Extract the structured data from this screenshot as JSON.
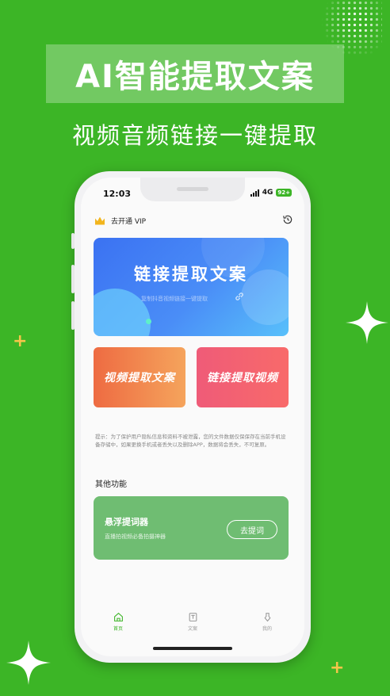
{
  "promo": {
    "headline": "AI智能提取文案",
    "subtitle": "视频音频链接一键提取"
  },
  "status_bar": {
    "time": "12:03",
    "network": "4G",
    "battery": "92+"
  },
  "header": {
    "vip_label": "去开通 VIP",
    "history_icon": "history-icon"
  },
  "banner": {
    "title": "链接提取文案",
    "subtitle": "复制抖音视频链接一键提取"
  },
  "actions": {
    "video_extract": "视频提取文案",
    "link_extract": "链接提取视频"
  },
  "notice": "提示：为了保护用户隐私信息和资料不被泄露，您的文件数据仅保保存在当前手机设备存储中，如果更换手机或者丢失以及删除APP，数据将会丢失，不可复原。",
  "other_functions": {
    "section_title": "其他功能",
    "teleprompter": {
      "title": "悬浮提词器",
      "description": "直播拍视频必备拍摄神器",
      "button": "去提词"
    }
  },
  "tabs": [
    {
      "label": "首页",
      "icon": "home-icon",
      "active": true
    },
    {
      "label": "文案",
      "icon": "document-icon",
      "active": false
    },
    {
      "label": "我的",
      "icon": "profile-icon",
      "active": false
    }
  ],
  "colors": {
    "background": "#3cb526",
    "accent": "#3cb526",
    "banner": "#4a8df7",
    "card_orange": "#ee6b42",
    "card_pink": "#ef5b78",
    "function_card": "#6fbd72"
  }
}
